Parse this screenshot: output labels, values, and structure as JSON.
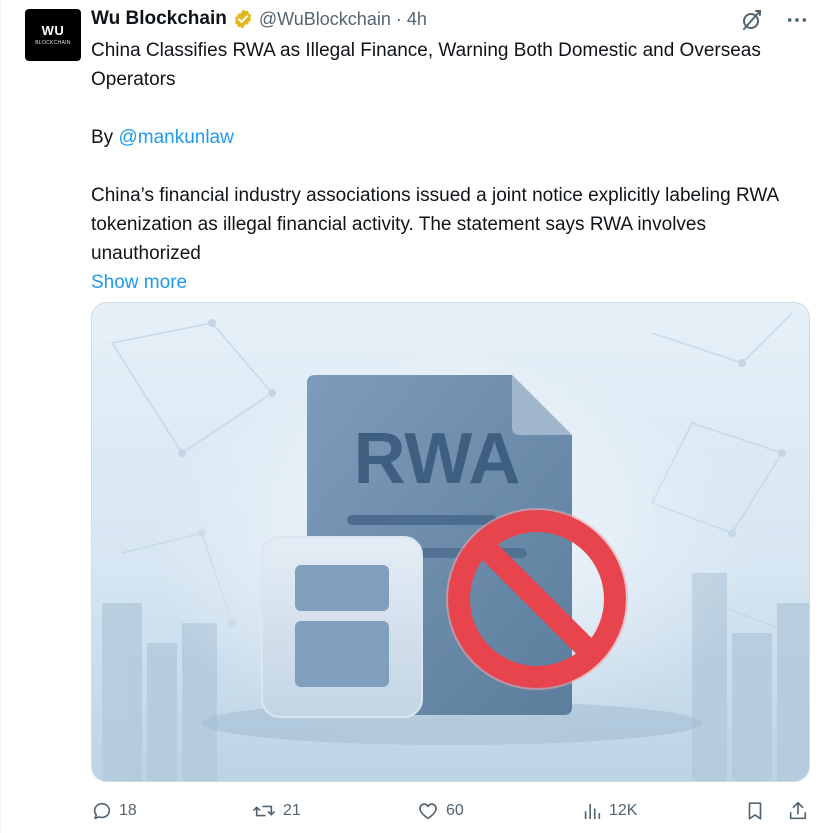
{
  "author": {
    "display_name": "Wu Blockchain",
    "handle": "@WuBlockchain",
    "separator": "·",
    "time": "4h",
    "verified": true,
    "avatar_text": "WU",
    "avatar_subtext": "BLOCKCHAIN"
  },
  "tweet": {
    "title_line": "China Classifies RWA as Illegal Finance, Warning Both Domestic and Overseas Operators",
    "by_prefix": "By ",
    "by_mention": "@mankunlaw",
    "body": "China’s financial industry associations issued a joint notice explicitly labeling RWA tokenization as illegal financial activity. The statement says RWA involves unauthorized",
    "show_more": "Show more"
  },
  "media": {
    "document_label": "RWA"
  },
  "actions": {
    "replies": "18",
    "reposts": "21",
    "likes": "60",
    "views": "12K"
  },
  "icons": {
    "grok": "slash-circle-icon",
    "more": "more-dots-icon",
    "reply": "reply-icon",
    "repost": "repost-icon",
    "like": "like-icon",
    "views": "views-icon",
    "bookmark": "bookmark-icon",
    "share": "share-icon"
  },
  "colors": {
    "accent": "#1d9bf0",
    "verified_gold": "#e2b719",
    "muted_text": "#536471",
    "prohibit_red": "#e8444e"
  }
}
